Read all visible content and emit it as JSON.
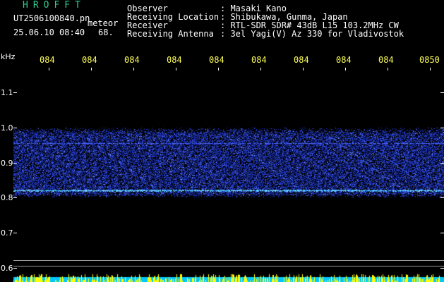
{
  "window": {
    "title": "HROFFT",
    "filename": "UT2506100840.pn",
    "mode": "meteor",
    "datetime": "25.06.10 08:40",
    "count": "68."
  },
  "info": [
    {
      "label": "Observer",
      "value": ": Masaki Kano"
    },
    {
      "label": "Receiving Location",
      "value": ": Shibukawa, Gunma, Japan"
    },
    {
      "label": "Receiver",
      "value": ": RTL-SDR SDR# 43dB L15 103.2MHz CW"
    },
    {
      "label": "Receiving Antenna",
      "value": ": 3el Yagi(V) Az 330 for Vladivostok"
    }
  ],
  "axis": {
    "unit": "kHz",
    "y_labels": [
      "1.1",
      "1.0",
      "0.9",
      "0.8",
      "0.7",
      "0.6"
    ],
    "time_labels": [
      "084",
      "084",
      "084",
      "084",
      "084",
      "084",
      "084",
      "084",
      "084",
      "0850"
    ]
  },
  "colors": {
    "background": "#000000",
    "title": "#2fd08f",
    "time_label": "#ffff5a",
    "noise_base": "#1a2fb0",
    "noise_bright": "#6f8cff",
    "trace": "#7fe0ff",
    "level_bar": "#ffff00",
    "level_base": "#00c8ff"
  }
}
